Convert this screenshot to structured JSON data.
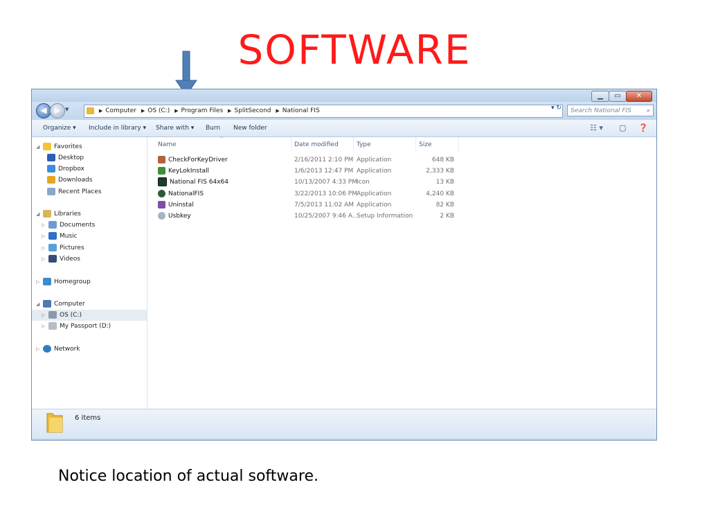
{
  "slide": {
    "title": "SOFTWARE",
    "caption": "Notice location of actual software."
  },
  "window": {
    "breadcrumb": [
      "Computer",
      "OS (C:)",
      "Program Files",
      "SplitSecond",
      "National FIS"
    ],
    "search_placeholder": "Search National FIS",
    "toolbar": {
      "organize": "Organize ▾",
      "include": "Include in library ▾",
      "share": "Share with ▾",
      "burn": "Burn",
      "new_folder": "New folder"
    },
    "columns": {
      "name": "Name",
      "date": "Date modified",
      "type": "Type",
      "size": "Size"
    },
    "files": [
      {
        "name": "CheckForKeyDriver",
        "date": "2/16/2011 2:10 PM",
        "type": "Application",
        "size": "648 KB",
        "icon": "application-icon"
      },
      {
        "name": "KeyLokInstall",
        "date": "1/6/2013 12:47 PM",
        "type": "Application",
        "size": "2,333 KB",
        "icon": "installer-icon"
      },
      {
        "name": "National FIS 64x64",
        "date": "10/13/2007 4:33 PM",
        "type": "Icon",
        "size": "13 KB",
        "icon": "icon-file-icon"
      },
      {
        "name": "NationalFIS",
        "date": "3/22/2013 10:06 PM",
        "type": "Application",
        "size": "4,240 KB",
        "icon": "application-icon"
      },
      {
        "name": "Uninstal",
        "date": "7/5/2013 11:02 AM",
        "type": "Application",
        "size": "82 KB",
        "icon": "uninstall-icon"
      },
      {
        "name": "Usbkey",
        "date": "10/25/2007 9:46 A...",
        "type": "Setup Information",
        "size": "2 KB",
        "icon": "setup-info-icon"
      }
    ],
    "nav": {
      "favorites": "Favorites",
      "desktop": "Desktop",
      "dropbox": "Dropbox",
      "downloads": "Downloads",
      "recent": "Recent Places",
      "libraries": "Libraries",
      "documents": "Documents",
      "music": "Music",
      "pictures": "Pictures",
      "videos": "Videos",
      "homegroup": "Homegroup",
      "computer": "Computer",
      "os_c": "OS (C:)",
      "passport": "My Passport (D:)",
      "network": "Network"
    },
    "status": {
      "item_count": "6 items"
    }
  },
  "colors": {
    "title": "#ff1a1a",
    "arrow": "#4f7fb8"
  }
}
